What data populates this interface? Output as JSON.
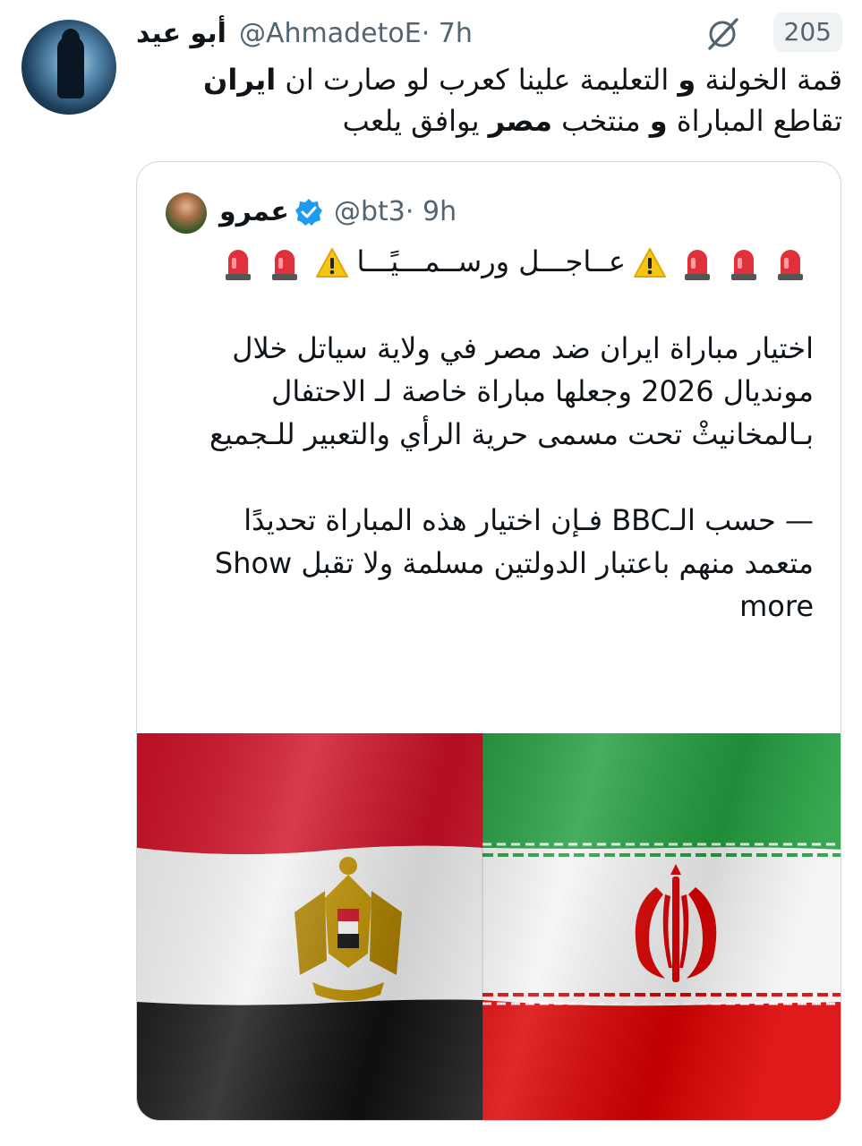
{
  "tweet": {
    "author_name": "أبو عيد",
    "handle": "@AhmadetoE",
    "time": "· 7h",
    "views": "205",
    "text_line1_part1": "قمة الخولنة ",
    "text_line1_bold1": "و",
    "text_line1_part2": " التعليمة علينا كعرب لو صارت ان ",
    "text_line1_bold2": "ايران",
    "text_line2_part1": " تقاطع المباراة ",
    "text_line2_bold1": "و",
    "text_line2_part2": " منتخب ",
    "text_line2_bold2": "مصر",
    "text_line2_part3": " يوافق يلعب"
  },
  "quote": {
    "author_name": "عمرو",
    "handle": "@bt3",
    "time": "· 9h",
    "headline": "عــاجـــل ورســمـــيًـــا",
    "paragraph1": "اختيار مباراة ايران ضد مصر في ولاية سياتل خلال مونديال 2026 وجعلها مباراة خاصة لـ الاحتفال بـالمخانيثْ تحت مسمى حرية الرأي والتعبير للـجميع",
    "paragraph2": "— حسب الـBBC فـإن اختيار هذه المباراة تحديدًا متعمد منهم باعتبار الدولتين مسلمة ولا تقبل",
    "show_more": "Show more"
  },
  "icons": {
    "grok": "grok-icon",
    "verified": "verified-badge-icon",
    "siren": "police-light-emoji",
    "warning": "warning-emoji"
  },
  "colors": {
    "verified_blue": "#1d9bf0",
    "secondary_text": "#536471",
    "egypt_red": "#ce1126",
    "iran_green": "#239f40",
    "iran_red": "#da0000",
    "eagle_gold": "#c09300"
  }
}
